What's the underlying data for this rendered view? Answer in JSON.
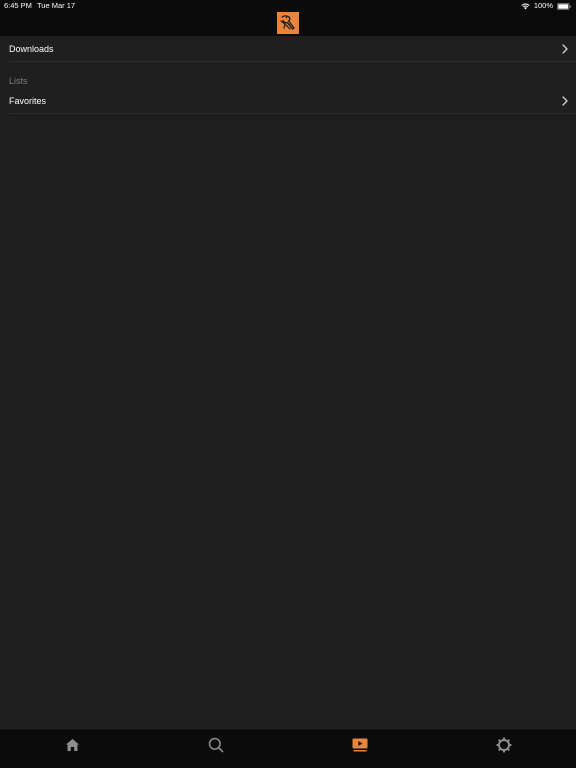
{
  "status_bar": {
    "time": "6:45 PM",
    "date": "Tue Mar 17",
    "battery": "100%"
  },
  "nav": {
    "logo_icon": "app-logo-icon"
  },
  "rows": {
    "downloads": {
      "label": "Downloads",
      "icon": "chevron-right-icon"
    },
    "favorites": {
      "label": "Favorites",
      "icon": "chevron-right-icon"
    }
  },
  "sections": {
    "lists_header": "Lists"
  },
  "tab_bar": {
    "items": [
      {
        "icon": "home-icon",
        "active": false
      },
      {
        "icon": "search-icon",
        "active": false
      },
      {
        "icon": "library-icon",
        "active": true
      },
      {
        "icon": "settings-icon",
        "active": false
      }
    ]
  },
  "colors": {
    "accent": "#e8843e",
    "background": "#1f1f1f",
    "bar_background": "#0b0b0b",
    "inactive_icon": "#8e8e8e",
    "secondary_text": "#7d7d7d"
  }
}
